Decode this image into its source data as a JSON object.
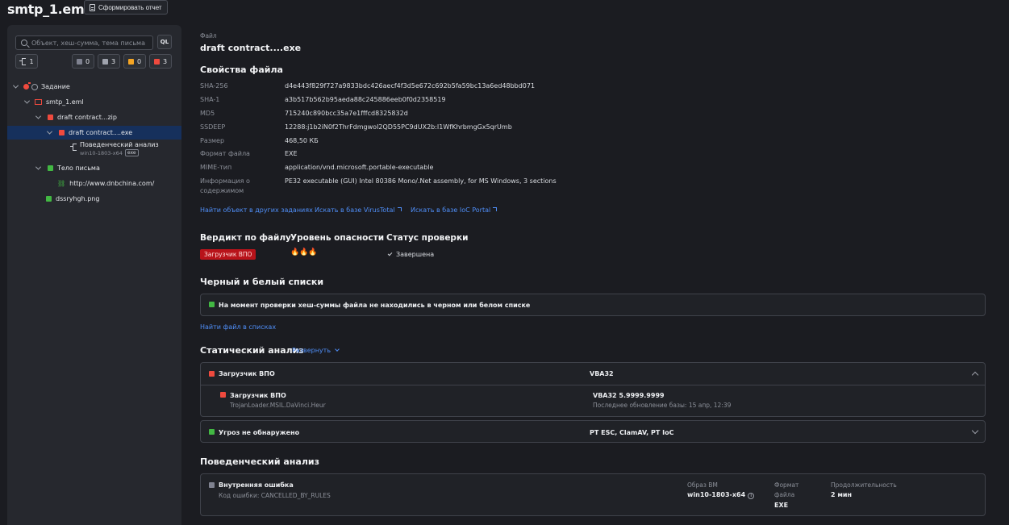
{
  "header": {
    "title": "smtp_1.eml",
    "report_button": "Сформировать отчет"
  },
  "sidebar": {
    "search_placeholder": "Объект, хеш-сумма, тема письма",
    "ql_label": "QL",
    "counters": {
      "tree": "1",
      "gray": "0",
      "files": "3",
      "yellow": "0",
      "red": "3"
    },
    "tree": [
      {
        "label": "Задание"
      },
      {
        "label": "smtp_1.eml"
      },
      {
        "label": "draft contract...zip"
      },
      {
        "label": "draft contract....exe"
      },
      {
        "label": "Поведенческий анализ",
        "sublabel": "win10-1803-x64",
        "tag": "exe"
      },
      {
        "label": "Тело письма"
      },
      {
        "label": "http://www.dnbchina.com/"
      },
      {
        "label": "dssryhgh.png"
      }
    ]
  },
  "file": {
    "kind_label": "Файл",
    "name": "draft contract....exe",
    "props_title": "Свойства файла",
    "props": [
      {
        "key": "SHA-256",
        "value": "d4e443f829f727a9833bdc426aecf4f3d5e672c692b5fa59bc13a6ed48bbd071"
      },
      {
        "key": "SHA-1",
        "value": "a3b517b562b95aeda88c245886eeb0f0d2358519"
      },
      {
        "key": "MD5",
        "value": "715240c890bcc35a7e1fffcd8325832d"
      },
      {
        "key": "SSDEEP",
        "value": "12288:j1b2iN0f2ThrFdmgwoI2QD55PC9dUX2b:I1WfKhrbmgGx5qrUmb"
      },
      {
        "key": "Размер",
        "value": "468,50 КБ"
      },
      {
        "key": "Формат файла",
        "value": "EXE"
      },
      {
        "key": "MIME-тип",
        "value": "application/vnd.microsoft.portable-executable"
      },
      {
        "key": "Информация о",
        "key2": "содержимом",
        "value": "PE32 executable (GUI) Intel 80386 Mono/.Net assembly, for MS Windows, 3 sections"
      }
    ],
    "links": {
      "other_tasks": "Найти объект в других заданиях",
      "virustotal": "Искать в базе VirusTotal",
      "iocportal": "Искать в базе IoC Portal"
    }
  },
  "verdict": {
    "verdict_title": "Вердикт по файлу",
    "verdict_value": "Загрузчик ВПО",
    "danger_title": "Уровень опасности",
    "danger_icons": "🔥🔥🔥",
    "status_title": "Статус проверки",
    "status_value": "Завершена"
  },
  "lists": {
    "title": "Черный и белый списки",
    "message": "На момент проверки хеш-суммы файла не находились в черном или белом списке",
    "find_link": "Найти файл в списках"
  },
  "static": {
    "title": "Статический анализ",
    "expand": "Развернуть",
    "group1": {
      "name": "Загрузчик ВПО",
      "engine": "VBA32",
      "detail_name": "Загрузчик ВПО",
      "detail_sig": "TrojanLoader.MSIL.DaVinci.Heur",
      "detail_engine": "VBA32 5.9999.9999",
      "detail_update": "Последнее обновление базы: 15 апр, 12:39"
    },
    "group2": {
      "name": "Угроз не обнаружено",
      "engines": "PT ESC, ClamAV, PT IoC"
    }
  },
  "behavior": {
    "title": "Поведенческий анализ",
    "error_title": "Внутренняя ошибка",
    "error_code": "Код ошибки: CANCELLED_BY_RULES",
    "vm_label": "Образ ВМ",
    "vm_value": "win10-1803-x64",
    "format_label_1": "Формат",
    "format_label_2": "файла",
    "format_value": "EXE",
    "duration_label": "Продолжительность",
    "duration_value": "2 мин"
  },
  "colors": {
    "red": "#ef4a3e",
    "green": "#42b843",
    "yellow": "#f5a524",
    "gray": "#7f8290",
    "link": "#4f8ef7",
    "selected": "#16305c"
  }
}
